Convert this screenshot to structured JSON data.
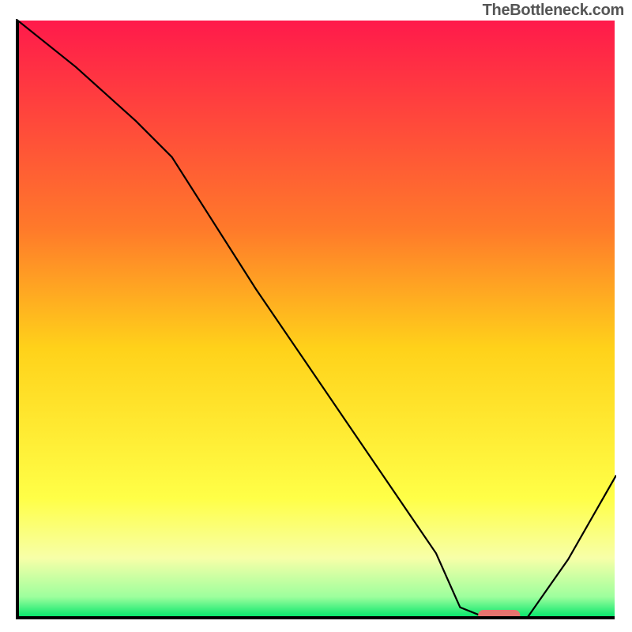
{
  "attribution": "TheBottleneck.com",
  "chart_data": {
    "type": "line",
    "title": "",
    "xlabel": "",
    "ylabel": "",
    "xlim": [
      0,
      100
    ],
    "ylim": [
      0,
      100
    ],
    "grid": false,
    "legend": false,
    "background_gradient": {
      "stops": [
        {
          "offset": 0.0,
          "color": "#ff1a4b"
        },
        {
          "offset": 0.35,
          "color": "#ff7a2a"
        },
        {
          "offset": 0.55,
          "color": "#ffd21a"
        },
        {
          "offset": 0.8,
          "color": "#ffff47"
        },
        {
          "offset": 0.9,
          "color": "#f7ffa8"
        },
        {
          "offset": 0.965,
          "color": "#9dff9d"
        },
        {
          "offset": 1.0,
          "color": "#00e56a"
        }
      ]
    },
    "series": [
      {
        "name": "bottleneck-curve",
        "x": [
          0,
          10,
          20,
          26,
          40,
          55,
          70,
          74,
          79,
          85,
          92,
          100
        ],
        "values": [
          100,
          92,
          83,
          77,
          55,
          33,
          11,
          2,
          0,
          0,
          10,
          24
        ]
      }
    ],
    "marker": {
      "x_start": 77,
      "x_end": 84,
      "y": 0,
      "color": "#e7746f"
    }
  }
}
